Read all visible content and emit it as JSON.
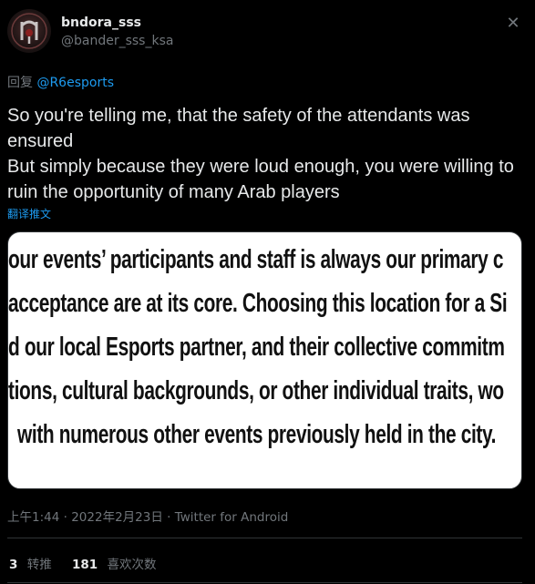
{
  "author": {
    "display_name": "bndora_sss",
    "handle": "@bander_sss_ksa"
  },
  "close_label": "✕",
  "reply": {
    "prefix": "回复",
    "mention": "@R6esports"
  },
  "tweet": {
    "paragraphs": [
      "So you're telling me, that the safety of the attendants was ensured",
      "But simply because they were loud enough, you were willing to ruin the opportunity of many Arab players"
    ],
    "translate_label": "翻译推文"
  },
  "media": {
    "lines": [
      "our events’ participants and staff is always our primary c",
      "acceptance are at its core. Choosing this location for a Si",
      "d our local Esports partner, and their collective commitm",
      "tions, cultural backgrounds, or other individual traits, wo",
      "with numerous other events previously held in the city."
    ]
  },
  "meta": {
    "time": "上午1:44",
    "separator": "·",
    "date": "2022年2月23日",
    "client": "Twitter for Android"
  },
  "stats": {
    "retweets_count": "3",
    "retweets_label": "转推",
    "likes_count": "181",
    "likes_label": "喜欢次数"
  },
  "colors": {
    "background": "#000000",
    "text": "#e7e9ea",
    "secondary": "#71767b",
    "accent": "#1d9bf0",
    "divider": "#2f3336"
  },
  "icons": {
    "avatar": "avatar-image",
    "close": "close-icon"
  }
}
